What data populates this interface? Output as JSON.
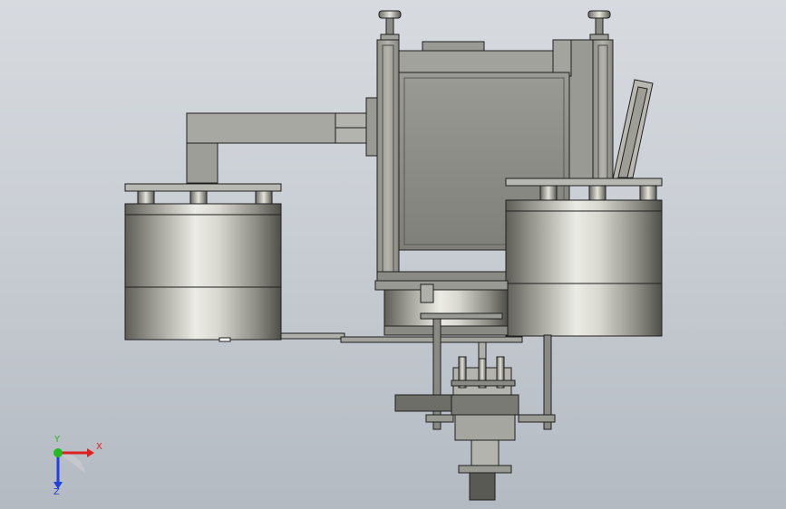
{
  "viewport": {
    "triad": {
      "x_label": "X",
      "y_label": "Y",
      "z_label": "Z",
      "colors": {
        "x": "#e02020",
        "y": "#22bb22",
        "z": "#2040e0"
      }
    }
  },
  "colors": {
    "background_top": "#d7dbe0",
    "background_bottom": "#b4bac2",
    "steel_light": "#e6e6e0",
    "steel_mid": "#a8a89e",
    "steel_dark": "#5a5a54",
    "plate_gray": "#8c8c86",
    "edge": "#1e1e1e"
  }
}
